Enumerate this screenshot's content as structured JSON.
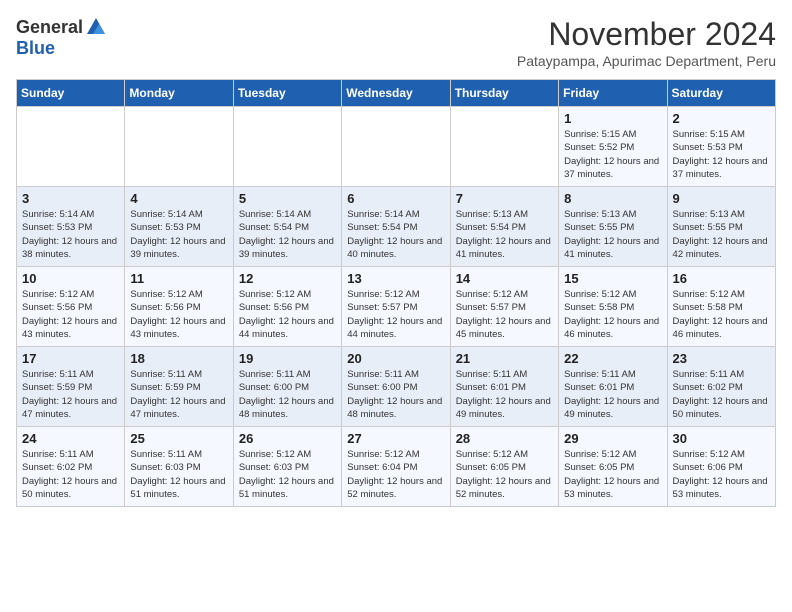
{
  "logo": {
    "general": "General",
    "blue": "Blue"
  },
  "title": "November 2024",
  "subtitle": "Pataypampa, Apurimac Department, Peru",
  "days_of_week": [
    "Sunday",
    "Monday",
    "Tuesday",
    "Wednesday",
    "Thursday",
    "Friday",
    "Saturday"
  ],
  "weeks": [
    [
      {
        "day": "",
        "info": ""
      },
      {
        "day": "",
        "info": ""
      },
      {
        "day": "",
        "info": ""
      },
      {
        "day": "",
        "info": ""
      },
      {
        "day": "",
        "info": ""
      },
      {
        "day": "1",
        "info": "Sunrise: 5:15 AM\nSunset: 5:52 PM\nDaylight: 12 hours and 37 minutes."
      },
      {
        "day": "2",
        "info": "Sunrise: 5:15 AM\nSunset: 5:53 PM\nDaylight: 12 hours and 37 minutes."
      }
    ],
    [
      {
        "day": "3",
        "info": "Sunrise: 5:14 AM\nSunset: 5:53 PM\nDaylight: 12 hours and 38 minutes."
      },
      {
        "day": "4",
        "info": "Sunrise: 5:14 AM\nSunset: 5:53 PM\nDaylight: 12 hours and 39 minutes."
      },
      {
        "day": "5",
        "info": "Sunrise: 5:14 AM\nSunset: 5:54 PM\nDaylight: 12 hours and 39 minutes."
      },
      {
        "day": "6",
        "info": "Sunrise: 5:14 AM\nSunset: 5:54 PM\nDaylight: 12 hours and 40 minutes."
      },
      {
        "day": "7",
        "info": "Sunrise: 5:13 AM\nSunset: 5:54 PM\nDaylight: 12 hours and 41 minutes."
      },
      {
        "day": "8",
        "info": "Sunrise: 5:13 AM\nSunset: 5:55 PM\nDaylight: 12 hours and 41 minutes."
      },
      {
        "day": "9",
        "info": "Sunrise: 5:13 AM\nSunset: 5:55 PM\nDaylight: 12 hours and 42 minutes."
      }
    ],
    [
      {
        "day": "10",
        "info": "Sunrise: 5:12 AM\nSunset: 5:56 PM\nDaylight: 12 hours and 43 minutes."
      },
      {
        "day": "11",
        "info": "Sunrise: 5:12 AM\nSunset: 5:56 PM\nDaylight: 12 hours and 43 minutes."
      },
      {
        "day": "12",
        "info": "Sunrise: 5:12 AM\nSunset: 5:56 PM\nDaylight: 12 hours and 44 minutes."
      },
      {
        "day": "13",
        "info": "Sunrise: 5:12 AM\nSunset: 5:57 PM\nDaylight: 12 hours and 44 minutes."
      },
      {
        "day": "14",
        "info": "Sunrise: 5:12 AM\nSunset: 5:57 PM\nDaylight: 12 hours and 45 minutes."
      },
      {
        "day": "15",
        "info": "Sunrise: 5:12 AM\nSunset: 5:58 PM\nDaylight: 12 hours and 46 minutes."
      },
      {
        "day": "16",
        "info": "Sunrise: 5:12 AM\nSunset: 5:58 PM\nDaylight: 12 hours and 46 minutes."
      }
    ],
    [
      {
        "day": "17",
        "info": "Sunrise: 5:11 AM\nSunset: 5:59 PM\nDaylight: 12 hours and 47 minutes."
      },
      {
        "day": "18",
        "info": "Sunrise: 5:11 AM\nSunset: 5:59 PM\nDaylight: 12 hours and 47 minutes."
      },
      {
        "day": "19",
        "info": "Sunrise: 5:11 AM\nSunset: 6:00 PM\nDaylight: 12 hours and 48 minutes."
      },
      {
        "day": "20",
        "info": "Sunrise: 5:11 AM\nSunset: 6:00 PM\nDaylight: 12 hours and 48 minutes."
      },
      {
        "day": "21",
        "info": "Sunrise: 5:11 AM\nSunset: 6:01 PM\nDaylight: 12 hours and 49 minutes."
      },
      {
        "day": "22",
        "info": "Sunrise: 5:11 AM\nSunset: 6:01 PM\nDaylight: 12 hours and 49 minutes."
      },
      {
        "day": "23",
        "info": "Sunrise: 5:11 AM\nSunset: 6:02 PM\nDaylight: 12 hours and 50 minutes."
      }
    ],
    [
      {
        "day": "24",
        "info": "Sunrise: 5:11 AM\nSunset: 6:02 PM\nDaylight: 12 hours and 50 minutes."
      },
      {
        "day": "25",
        "info": "Sunrise: 5:11 AM\nSunset: 6:03 PM\nDaylight: 12 hours and 51 minutes."
      },
      {
        "day": "26",
        "info": "Sunrise: 5:12 AM\nSunset: 6:03 PM\nDaylight: 12 hours and 51 minutes."
      },
      {
        "day": "27",
        "info": "Sunrise: 5:12 AM\nSunset: 6:04 PM\nDaylight: 12 hours and 52 minutes."
      },
      {
        "day": "28",
        "info": "Sunrise: 5:12 AM\nSunset: 6:05 PM\nDaylight: 12 hours and 52 minutes."
      },
      {
        "day": "29",
        "info": "Sunrise: 5:12 AM\nSunset: 6:05 PM\nDaylight: 12 hours and 53 minutes."
      },
      {
        "day": "30",
        "info": "Sunrise: 5:12 AM\nSunset: 6:06 PM\nDaylight: 12 hours and 53 minutes."
      }
    ]
  ]
}
